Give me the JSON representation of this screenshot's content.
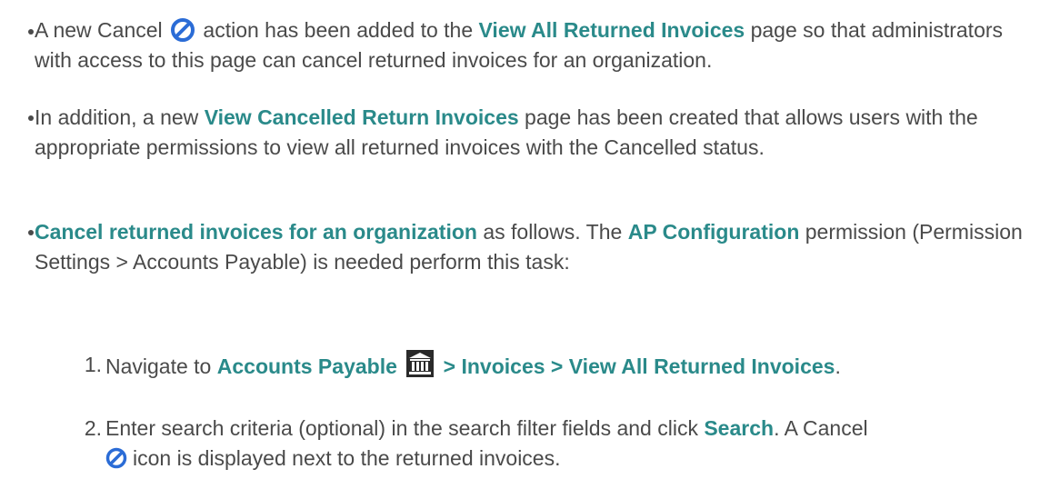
{
  "bullets": [
    {
      "pre": "A new Cancel",
      "mid": " action has been added to the ",
      "bold1": "View All Returned Invoices",
      "post": " page so that administrators with access to this page can cancel returned invoices for an organization."
    },
    {
      "pre": "In addition, a new ",
      "bold1": "View Cancelled Return Invoices",
      "post": " page has been created that allows users with the appropriate permissions to view all returned invoices with the Cancelled status."
    },
    {
      "bold1": "Cancel returned invoices for an organization",
      "mid": " as follows. The ",
      "bold2": "AP Configuration",
      "post": " permission (Permission Settings > Accounts Payable) is needed perform this task:"
    }
  ],
  "steps": [
    {
      "num": "1.",
      "pre": "Navigate to ",
      "bold1": "Accounts Payable",
      "bold2": " > Invoices > View All Returned Invoices",
      "post": "."
    },
    {
      "num": "2.",
      "pre": "Enter search criteria (optional) in the search filter fields and click ",
      "bold1": "Search",
      "mid": ". A Cancel",
      "post": "icon is displayed next to the returned invoices."
    }
  ],
  "colors": {
    "text": "#4a4a4a",
    "bold": "#2a8a8a",
    "cancel_icon": "#2b6cd6"
  },
  "icons": [
    "cancel-icon",
    "bank-icon"
  ]
}
